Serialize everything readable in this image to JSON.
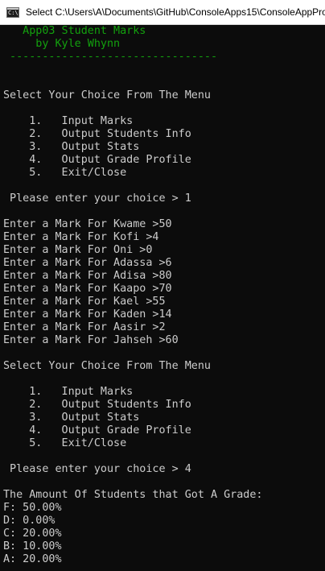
{
  "window": {
    "title": "Select C:\\Users\\A\\Documents\\GitHub\\ConsoleApps15\\ConsoleAppPro",
    "icon": "console-app-icon",
    "icon_glyph": "C:\\"
  },
  "header": {
    "title": "   App03 Student Marks",
    "byline": "     by Kyle Whynn",
    "divider": " --------------------------------"
  },
  "menu_prompt_1": "Select Your Choice From The Menu",
  "menu_1": [
    "    1.   Input Marks",
    "    2.   Output Students Info",
    "    3.   Output Stats",
    "    4.   Output Grade Profile",
    "    5.   Exit/Close"
  ],
  "choice_prompt_1": " Please enter your choice > 1",
  "marks_entries": [
    "Enter a Mark For Kwame >50",
    "Enter a Mark For Kofi >4",
    "Enter a Mark For Oni >0",
    "Enter a Mark For Adassa >6",
    "Enter a Mark For Adisa >80",
    "Enter a Mark For Kaapo >70",
    "Enter a Mark For Kael >55",
    "Enter a Mark For Kaden >14",
    "Enter a Mark For Aasir >2",
    "Enter a Mark For Jahseh >60"
  ],
  "menu_prompt_2": "Select Your Choice From The Menu",
  "menu_2": [
    "    1.   Input Marks",
    "    2.   Output Students Info",
    "    3.   Output Stats",
    "    4.   Output Grade Profile",
    "    5.   Exit/Close"
  ],
  "choice_prompt_2": " Please enter your choice > 4",
  "grade_heading": "The Amount Of Students that Got A Grade:",
  "grades": [
    "F: 50.00%",
    "D: 0.00%",
    "C: 20.00%",
    "B: 10.00%",
    "A: 20.00%"
  ],
  "colors": {
    "background": "#0c0c0c",
    "text": "#cccccc",
    "header_green": "#13a10e"
  }
}
